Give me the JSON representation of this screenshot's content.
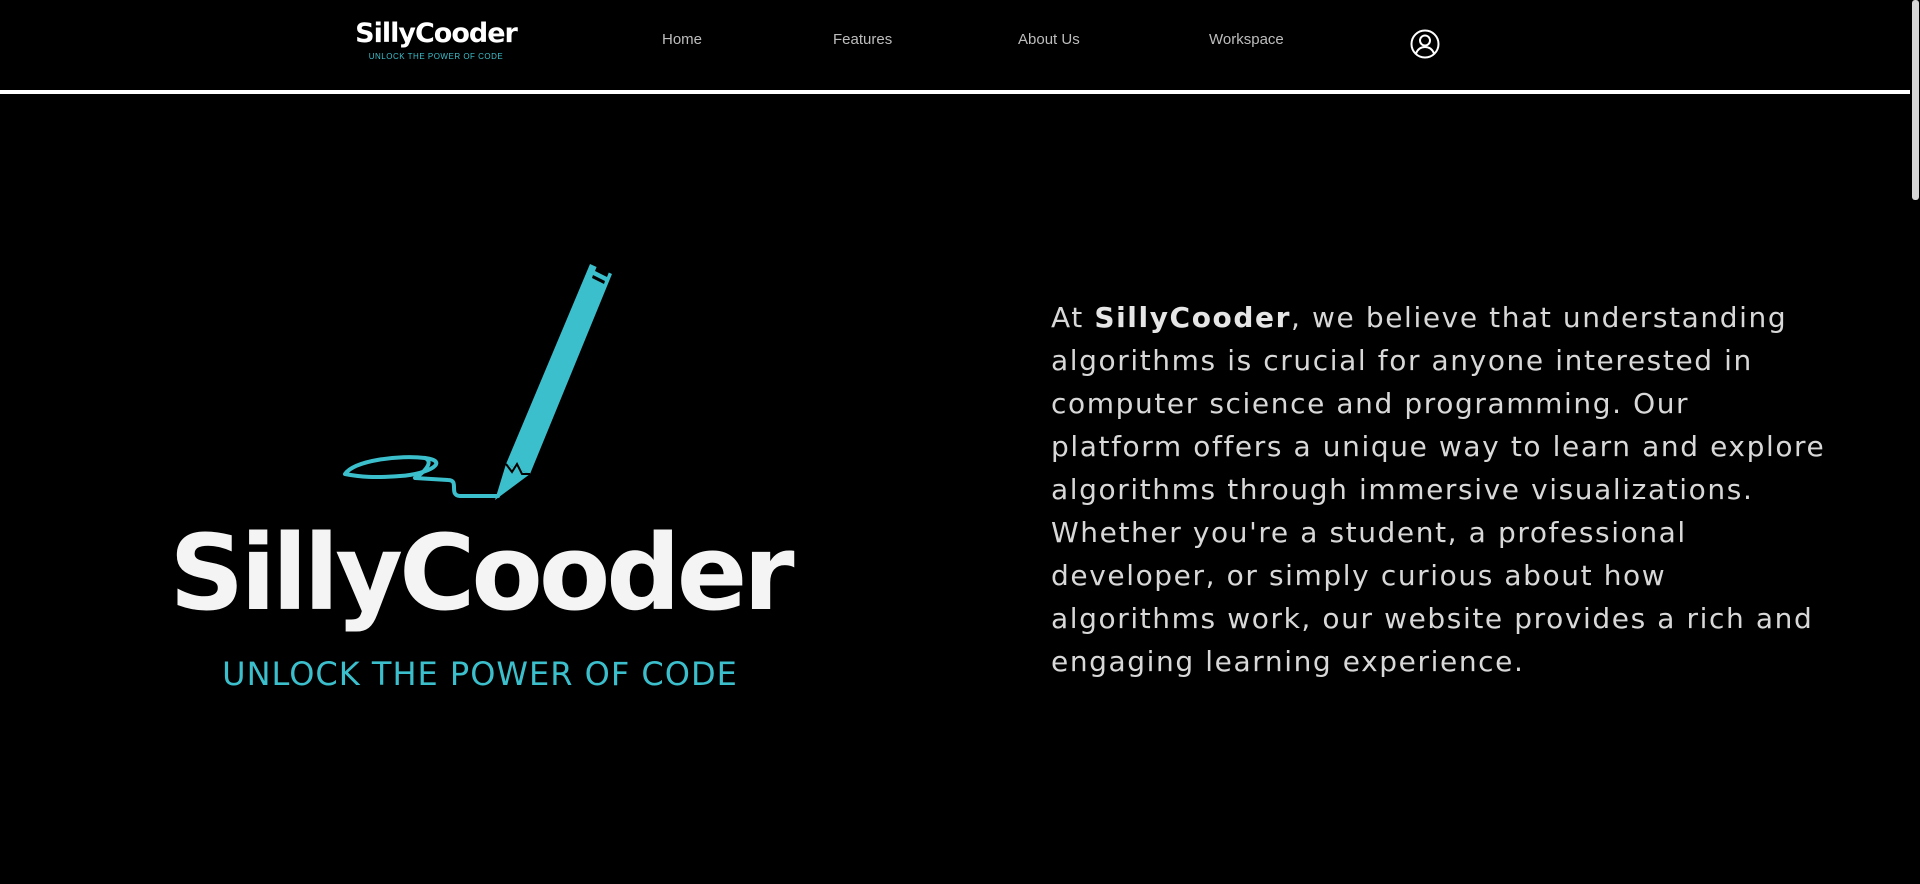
{
  "header": {
    "logo": {
      "name": "SillyCooder",
      "tagline": "UNLOCK THE POWER OF CODE"
    },
    "nav": [
      {
        "label": "Home"
      },
      {
        "label": "Features"
      },
      {
        "label": "About Us"
      },
      {
        "label": "Workspace"
      }
    ],
    "user_icon": "user-circle-icon"
  },
  "hero": {
    "logo": {
      "name": "SillyCooder",
      "tagline": "UNLOCK THE POWER OF CODE",
      "icon": "pencil-scribble-icon"
    },
    "text": {
      "prefix": "At ",
      "brand": "SillyCooder",
      "body": ", we believe that understanding algorithms is crucial for anyone interested in computer science and programming. Our platform offers a unique way to learn and explore algorithms through immersive visualizations. Whether you're a student, a professional developer, or simply curious about how algorithms work, our website provides a rich and engaging learning experience."
    }
  },
  "colors": {
    "background": "#000000",
    "accent": "#3cbfcc",
    "text": "#d8d8d8",
    "nav_text": "#bdbdbd"
  }
}
